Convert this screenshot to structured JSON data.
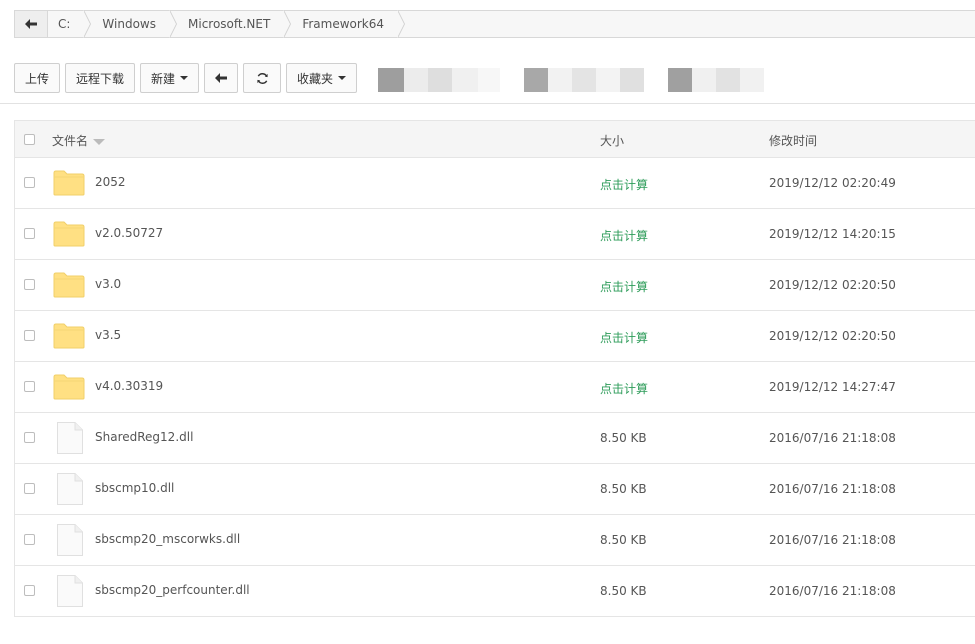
{
  "breadcrumb": [
    "C:",
    "Windows",
    "Microsoft.NET",
    "Framework64"
  ],
  "toolbar": {
    "upload": "上传",
    "remote_download": "远程下载",
    "new": "新建",
    "favorites": "收藏夹"
  },
  "table": {
    "headers": {
      "name": "文件名",
      "size": "大小",
      "modified": "修改时间"
    },
    "rows": [
      {
        "type": "folder",
        "name": "2052",
        "size": "点击计算",
        "modified": "2019/12/12 02:20:49"
      },
      {
        "type": "folder",
        "name": "v2.0.50727",
        "size": "点击计算",
        "modified": "2019/12/12 14:20:15"
      },
      {
        "type": "folder",
        "name": "v3.0",
        "size": "点击计算",
        "modified": "2019/12/12 02:20:50"
      },
      {
        "type": "folder",
        "name": "v3.5",
        "size": "点击计算",
        "modified": "2019/12/12 02:20:50"
      },
      {
        "type": "folder",
        "name": "v4.0.30319",
        "size": "点击计算",
        "modified": "2019/12/12 14:27:47"
      },
      {
        "type": "file",
        "name": "SharedReg12.dll",
        "size": "8.50 KB",
        "modified": "2016/07/16 21:18:08"
      },
      {
        "type": "file",
        "name": "sbscmp10.dll",
        "size": "8.50 KB",
        "modified": "2016/07/16 21:18:08"
      },
      {
        "type": "file",
        "name": "sbscmp20_mscorwks.dll",
        "size": "8.50 KB",
        "modified": "2016/07/16 21:18:08"
      },
      {
        "type": "file",
        "name": "sbscmp20_perfcounter.dll",
        "size": "8.50 KB",
        "modified": "2016/07/16 21:18:08"
      }
    ]
  },
  "colors": {
    "calc_link": "#2e9c5a",
    "folder": "#ffe083"
  }
}
